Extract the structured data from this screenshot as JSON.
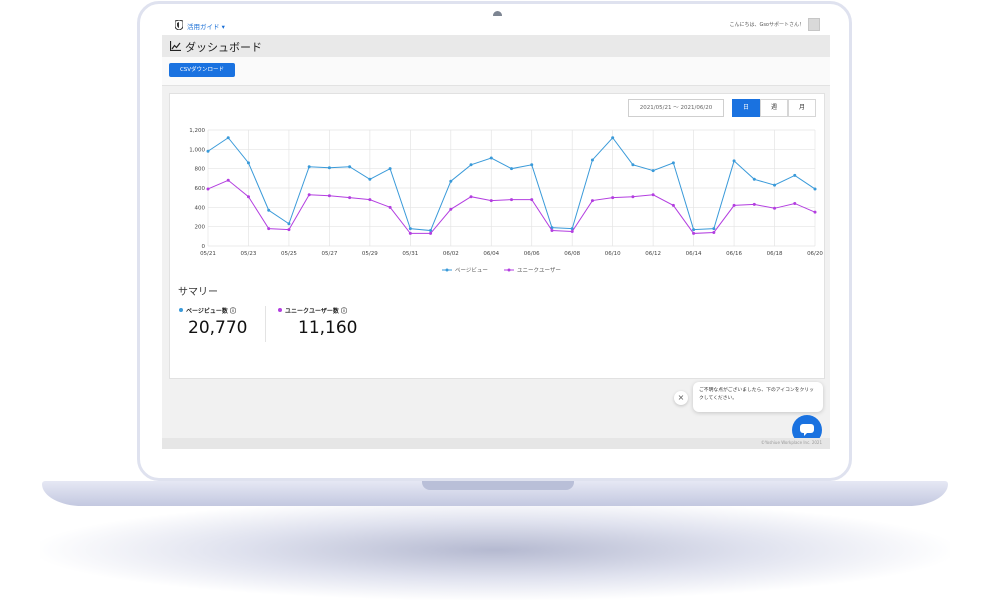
{
  "header": {
    "guide_link": "活用ガイド ▾",
    "greeting": "こんにちは、Gsoサポートさん！"
  },
  "page": {
    "title": "ダッシュボード"
  },
  "toolbar": {
    "csv_download": "CSVダウンロード"
  },
  "filters": {
    "date_range": "2021/05/21 〜 2021/06/20",
    "periods": [
      {
        "label": "日",
        "active": true
      },
      {
        "label": "週",
        "active": false
      },
      {
        "label": "月",
        "active": false
      }
    ]
  },
  "chart_data": {
    "type": "line",
    "x": [
      "05/21",
      "05/22",
      "05/23",
      "05/24",
      "05/25",
      "05/26",
      "05/27",
      "05/28",
      "05/29",
      "05/30",
      "05/31",
      "06/01",
      "06/02",
      "06/03",
      "06/04",
      "06/05",
      "06/06",
      "06/07",
      "06/08",
      "06/09",
      "06/10",
      "06/11",
      "06/12",
      "06/13",
      "06/14",
      "06/15",
      "06/16",
      "06/17",
      "06/18",
      "06/19",
      "06/20"
    ],
    "xtick_labels": [
      "05/21",
      "05/23",
      "05/25",
      "05/27",
      "05/29",
      "05/31",
      "06/02",
      "06/04",
      "06/06",
      "06/08",
      "06/10",
      "06/12",
      "06/14",
      "06/16",
      "06/18",
      "06/20"
    ],
    "ytick_labels": [
      "0",
      "200",
      "400",
      "600",
      "800",
      "1,000",
      "1,200"
    ],
    "ylim": [
      0,
      1200
    ],
    "grid": true,
    "legend_position": "bottom",
    "series": [
      {
        "name": "ページビュー",
        "color": "#3a9ad9",
        "values": [
          980,
          1120,
          860,
          370,
          230,
          820,
          810,
          820,
          690,
          800,
          180,
          160,
          670,
          840,
          910,
          800,
          840,
          190,
          180,
          890,
          1120,
          840,
          780,
          860,
          170,
          180,
          880,
          690,
          630,
          730,
          590
        ]
      },
      {
        "name": "ユニークユーザー",
        "color": "#b33ee0",
        "values": [
          590,
          680,
          510,
          180,
          170,
          530,
          520,
          500,
          480,
          400,
          130,
          130,
          380,
          510,
          470,
          480,
          480,
          160,
          150,
          470,
          500,
          510,
          530,
          420,
          130,
          140,
          420,
          430,
          390,
          440,
          350
        ]
      }
    ]
  },
  "summary": {
    "title": "サマリー",
    "metrics": [
      {
        "label": "ページビュー数 ⓘ",
        "value": "20,770",
        "color": "#3a9ad9"
      },
      {
        "label": "ユニークユーザー数 ⓘ",
        "value": "11,160",
        "color": "#b33ee0"
      }
    ]
  },
  "chat": {
    "message": "ご不明な点がございましたら、下のアイコンをクリックしてください。",
    "close_symbol": "×"
  },
  "footer": {
    "copyright": "©Yoshiue Workplace Inc. 2021"
  }
}
